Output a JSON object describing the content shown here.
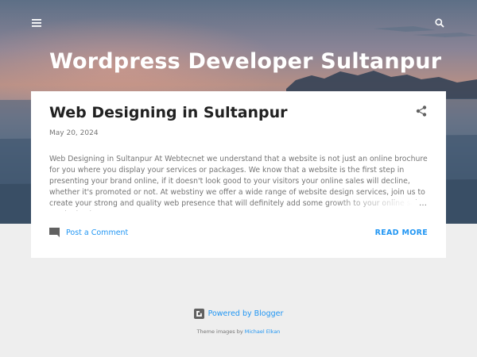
{
  "header": {
    "title": "Wordpress Developer Sultanpur",
    "menu_icon": "hamburger-menu-icon",
    "search_icon": "search-icon"
  },
  "post": {
    "title": "Web Designing in Sultanpur",
    "date": "May 20, 2024",
    "snippet": " Web Designing in Sultanpur At Webtecnet we understand that a website is not just an online brochure for you where you display your services or packages. We know that a website is the first step in presenting your brand online, if it doesn't look good to your visitors your online sales will decline, whether it's promoted or not. At webstiny we offer a wide range of website design services, join us to create your strong and quality web presence that will definitely add some growth to your online sales . webstiny is",
    "ellipsis": "…",
    "comment_label": "Post a Comment",
    "read_more_label": "READ MORE",
    "share_icon": "share-icon",
    "comment_icon": "comment-icon"
  },
  "footer": {
    "powered_by": "Powered by Blogger",
    "theme_images_prefix": "Theme images by ",
    "theme_images_author": "Michael Elkan"
  },
  "colors": {
    "accent": "#2196f3",
    "text_dark": "#212121",
    "text_muted": "#757575",
    "page_bg": "#eeeeee"
  }
}
